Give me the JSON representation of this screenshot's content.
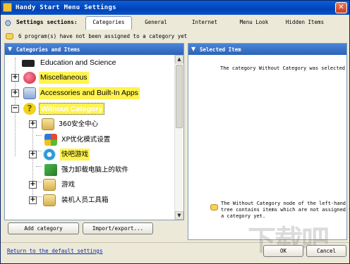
{
  "window": {
    "title": "Handy Start Menu Settings",
    "close_glyph": "✕"
  },
  "sections": {
    "label": "Settings sections:",
    "tabs": [
      "Categories",
      "General",
      "Internet",
      "Menu Look",
      "Hidden Items"
    ],
    "active_tab": "Categories"
  },
  "notice": "6 program(s) have not been assigned to a category yet",
  "left_panel": {
    "header": "Categories and Items",
    "tree": [
      {
        "label": "Education and Science",
        "icon": "graduation-cap-icon",
        "highlight": false
      },
      {
        "label": "Miscellaneous",
        "icon": "heart-icon",
        "highlight": true
      },
      {
        "label": "Accessories and Built-In Apps",
        "icon": "calculator-icon",
        "highlight": true
      },
      {
        "label": "Without Category",
        "icon": "question-mark-icon",
        "selected": true
      },
      {
        "label": "360安全中心",
        "icon": "folder-icon"
      },
      {
        "label": "XP优化模式设置",
        "icon": "windows-logo-icon"
      },
      {
        "label": "快吧游戏",
        "icon": "game-icon",
        "highlight": true
      },
      {
        "label": "强力卸载电脑上的软件",
        "icon": "uninstall-icon"
      },
      {
        "label": "游戏",
        "icon": "folder-icon"
      },
      {
        "label": "装机人员工具箱",
        "icon": "folder-icon"
      }
    ]
  },
  "right_panel": {
    "header": "Selected Item",
    "selected_text": "The category Without Category was selected",
    "hint": "The Without Category node of the left-hand tree contains items which are not assigned to a category yet."
  },
  "buttons": {
    "add_category": "Add category",
    "import_export": "Import/export...",
    "ok": "OK",
    "cancel": "Cancel"
  },
  "footer": {
    "default_link": "Return to the default settings"
  },
  "colors": {
    "highlight": "#fff34f",
    "header_blue": "#2a62b8",
    "title_blue": "#0142b8"
  }
}
